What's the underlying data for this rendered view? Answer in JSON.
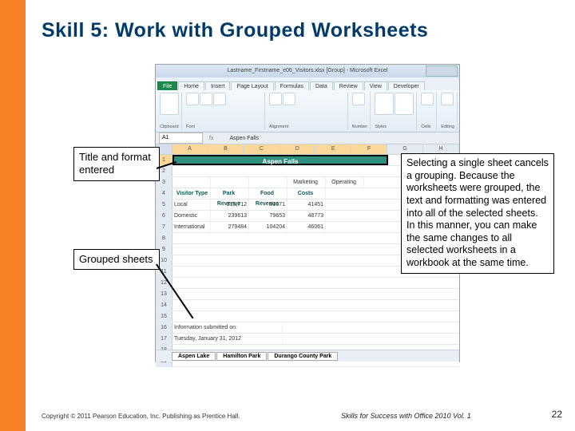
{
  "slide": {
    "title": "Skill 5: Work with Grouped Worksheets",
    "page_number": "22"
  },
  "footer": {
    "copyright": "Copyright © 2011 Pearson Education, Inc. Publishing as Prentice Hall.",
    "book": "Skills for Success with Office 2010 Vol. 1"
  },
  "callouts": {
    "title_format": "Title and format entered",
    "grouped": "Grouped sheets",
    "explain": "Selecting a single sheet cancels a grouping. Because the worksheets were grouped, the text and formatting was entered into all of the selected sheets. In this manner, you can make the same changes to all selected worksheets in a workbook at the same time."
  },
  "excel": {
    "window_title": "Lastname_Firstname_e06_Visitors.xlsx  [Group] - Microsoft Excel",
    "tabs": [
      "File",
      "Home",
      "Insert",
      "Page Layout",
      "Formulas",
      "Data",
      "Review",
      "View",
      "Developer"
    ],
    "name_box": "A1",
    "formula_bar": "Aspen Falls",
    "columns": [
      "A",
      "B",
      "C",
      "D",
      "E",
      "F",
      "G",
      "H"
    ],
    "merged_title": "Aspen Falls",
    "section_headers": {
      "d": "Marketing",
      "e": "Operating"
    },
    "col_headers": {
      "a": "Visitor Type",
      "b": "Park Revenue",
      "c": "Food Revenue",
      "d": "Costs"
    },
    "data_rows": [
      {
        "type": "Local",
        "park": "215,712",
        "food": "81671",
        "costs": "41451"
      },
      {
        "type": "Domestic",
        "park": "239613",
        "food": "79653",
        "costs": "48773"
      },
      {
        "type": "International",
        "park": "279484",
        "food": "104204",
        "costs": "46061"
      }
    ],
    "info_label": "Information submitted on:",
    "info_date": "Tuesday, January 31, 2012",
    "sheet_tabs": [
      "Aspen Lake",
      "Hamilton Park",
      "Durango County Park"
    ]
  }
}
